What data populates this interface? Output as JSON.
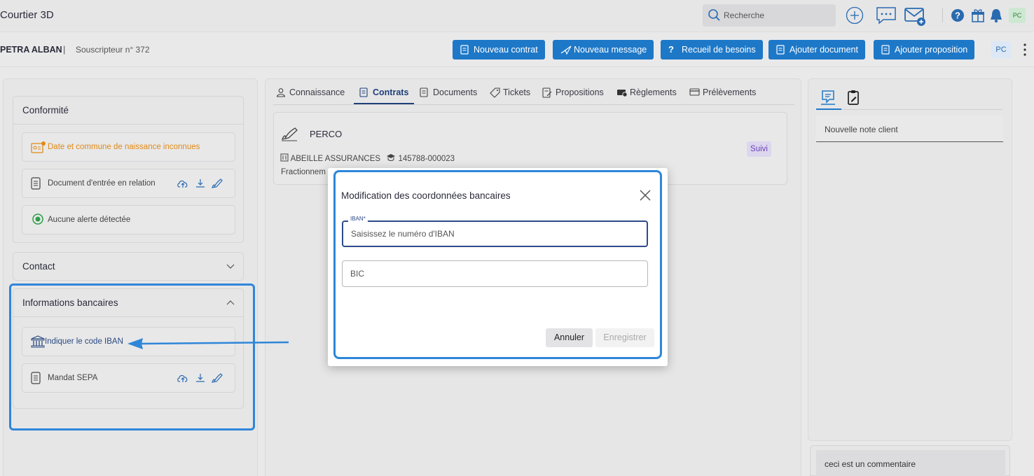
{
  "app": {
    "title": "Courtier 3D"
  },
  "topbar": {
    "search_placeholder": "Recherche",
    "avatar": "PC"
  },
  "client": {
    "name": "PETRA ALBAN",
    "separator": "|",
    "subscriber": "Souscripteur n° 372"
  },
  "actions": {
    "new_contract": "Nouveau contrat",
    "new_message": "Nouveau message",
    "needs": "Recueil de besoins",
    "add_document": "Ajouter document",
    "add_proposal": "Ajouter proposition",
    "user_badge": "PC"
  },
  "left": {
    "conformite": {
      "title": "Conformité",
      "items": [
        {
          "label": "Date et commune de naissance inconnues"
        },
        {
          "label": "Document d'entrée en relation"
        },
        {
          "label": "Aucune alerte détectée"
        }
      ]
    },
    "contact": {
      "title": "Contact"
    },
    "bancaires": {
      "title": "Informations bancaires",
      "items": [
        {
          "label": "Indiquer le code IBAN"
        },
        {
          "label": "Mandat SEPA"
        }
      ]
    }
  },
  "tabs": [
    {
      "label": "Connaissance"
    },
    {
      "label": "Contrats"
    },
    {
      "label": "Documents"
    },
    {
      "label": "Tickets"
    },
    {
      "label": "Propositions"
    },
    {
      "label": "Règlements"
    },
    {
      "label": "Prélèvements"
    }
  ],
  "contract": {
    "name": "PERCO",
    "insurer": "ABEILLE ASSURANCES",
    "number": "145788-000023",
    "fraction": "Fractionnem",
    "status": "Suivi"
  },
  "right": {
    "note_placeholder": "Nouvelle note client",
    "comment": "ceci est un commentaire"
  },
  "modal": {
    "title": "Modification des coordonnées bancaires",
    "iban_label": "IBAN*",
    "iban_placeholder": "Saisissez le numéro d'IBAN",
    "bic_placeholder": "BIC",
    "cancel": "Annuler",
    "save": "Enregistrer"
  },
  "colors": {
    "accent": "#1e78c8",
    "highlight": "#2e86d8",
    "warning": "#e08a16",
    "status": "#6b3fb8"
  }
}
